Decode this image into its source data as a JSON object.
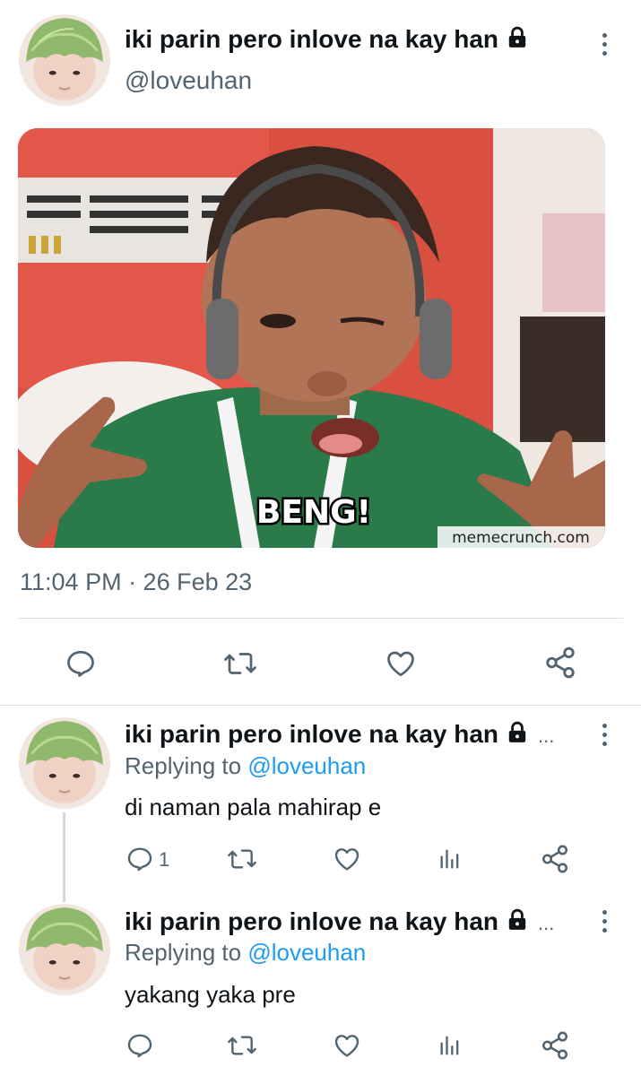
{
  "main_tweet": {
    "display_name": "iki parin pero inlove na kay han",
    "handle": "@loveuhan",
    "timestamp": "11:04 PM · 26 Feb 23",
    "media": {
      "overlay_text": "BENG!",
      "watermark": "memecrunch.com"
    }
  },
  "replies": [
    {
      "display_name": "iki parin pero inlove na kay han",
      "truncation": "...",
      "replying_to_prefix": "Replying to",
      "replying_to_handle": "@loveuhan",
      "text": "di naman pala mahirap e",
      "reply_count": "1"
    },
    {
      "display_name": "iki parin pero inlove na kay han",
      "truncation": "...",
      "replying_to_prefix": "Replying to",
      "replying_to_handle": "@loveuhan",
      "text": "yakang yaka pre",
      "reply_count": ""
    }
  ],
  "colors": {
    "text_primary": "#0f1419",
    "text_secondary": "#536471",
    "link": "#1d9bf0",
    "divider": "#dadfe2"
  },
  "icons": [
    "lock-icon",
    "more-icon",
    "reply-icon",
    "retweet-icon",
    "like-icon",
    "share-icon",
    "views-icon"
  ]
}
